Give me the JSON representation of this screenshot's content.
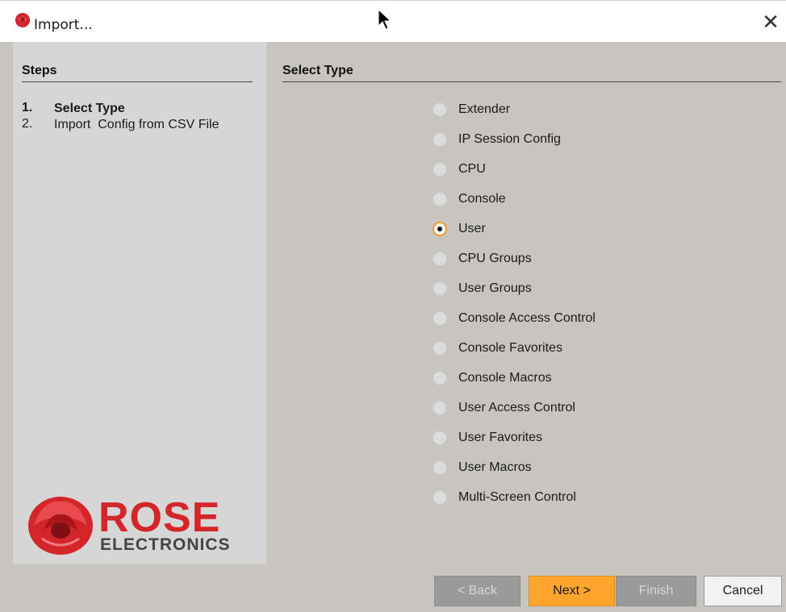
{
  "window": {
    "title": "Import...",
    "close_glyph": "✕",
    "icon": "rose-icon"
  },
  "steps": {
    "heading": "Steps",
    "items": [
      {
        "num": "1.",
        "label": "Select Type",
        "current": true
      },
      {
        "num": "2.",
        "label": "Import  Config from CSV File",
        "current": false
      }
    ]
  },
  "select_type": {
    "heading": "Select Type",
    "selected": "User",
    "accent_color": "#f39a2b",
    "options": [
      {
        "label": "Extender"
      },
      {
        "label": "IP Session Config"
      },
      {
        "label": "CPU"
      },
      {
        "label": "Console"
      },
      {
        "label": "User"
      },
      {
        "label": "CPU Groups"
      },
      {
        "label": "User Groups"
      },
      {
        "label": "Console Access Control"
      },
      {
        "label": "Console Favorites"
      },
      {
        "label": "Console Macros"
      },
      {
        "label": "User Access Control"
      },
      {
        "label": "User Favorites"
      },
      {
        "label": "User Macros"
      },
      {
        "label": "Multi-Screen Control"
      }
    ]
  },
  "logo": {
    "name": "ROSE",
    "sub": "ELECTRONICS",
    "brand_color": "#d4262a"
  },
  "buttons": {
    "back": "< Back",
    "next": "Next >",
    "finish": "Finish",
    "cancel": "Cancel",
    "next_color": "#ffa42c"
  }
}
